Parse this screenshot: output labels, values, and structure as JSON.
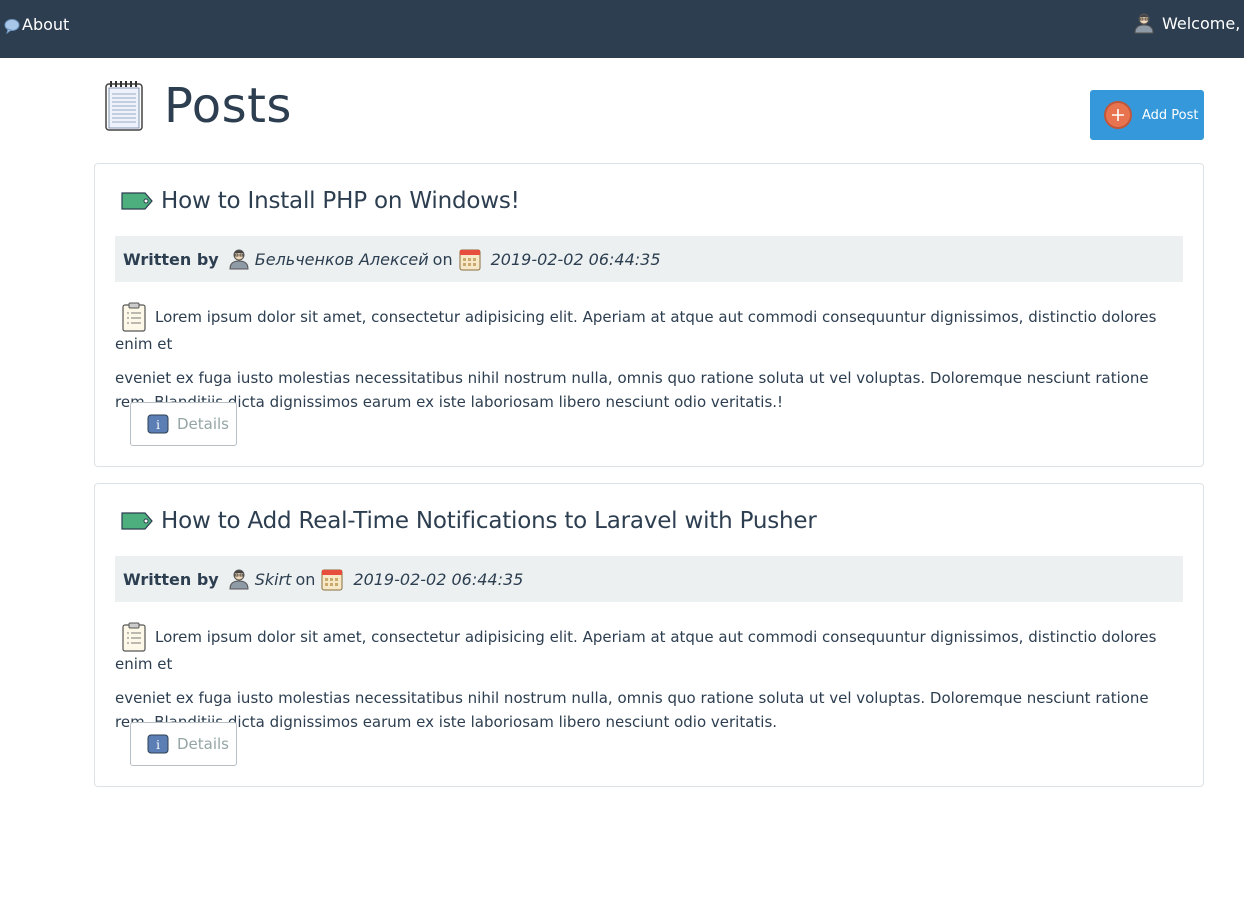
{
  "nav": {
    "about_label": "About",
    "welcome_text": "Welcome, E"
  },
  "page": {
    "title": "Posts",
    "add_post_label": "Add Post"
  },
  "posts": [
    {
      "title": "How to Install PHP on Windows!",
      "written_by_label": "Written by",
      "author": "Бельченков Алексей",
      "on_label": "on",
      "date": "2019-02-02 06:44:35",
      "body_line1": "Lorem ipsum dolor sit amet, consectetur adipisicing elit. Aperiam at atque aut commodi consequuntur dignissimos, distinctio dolores enim et",
      "body_rest": "eveniet ex fuga iusto molestias necessitatibus nihil nostrum nulla, omnis quo ratione soluta ut vel voluptas. Doloremque nesciunt ratione rem. Blanditiis dicta dignissimos earum ex iste laboriosam libero nesciunt odio veritatis.!",
      "details_label": "Details"
    },
    {
      "title": "How to Add Real-Time Notifications to Laravel with Pusher",
      "written_by_label": "Written by",
      "author": "Skirt",
      "on_label": "on",
      "date": "2019-02-02 06:44:35",
      "body_line1": "Lorem ipsum dolor sit amet, consectetur adipisicing elit. Aperiam at atque aut commodi consequuntur dignissimos, distinctio dolores enim et",
      "body_rest": "eveniet ex fuga iusto molestias necessitatibus nihil nostrum nulla, omnis quo ratione soluta ut vel voluptas. Doloremque nesciunt ratione rem. Blanditiis dicta dignissimos earum ex iste laboriosam libero nesciunt odio veritatis.",
      "details_label": "Details"
    }
  ],
  "colors": {
    "navbar": "#2c3e50",
    "primary": "#3498db",
    "meta_bg": "#ecf0f1",
    "tag_green": "#4caf7d"
  },
  "icons": [
    "speech-bubble-icon",
    "user-avatar-icon",
    "notepad-icon",
    "plus-icon",
    "tag-icon",
    "calendar-icon",
    "clipboard-icon",
    "info-icon"
  ]
}
